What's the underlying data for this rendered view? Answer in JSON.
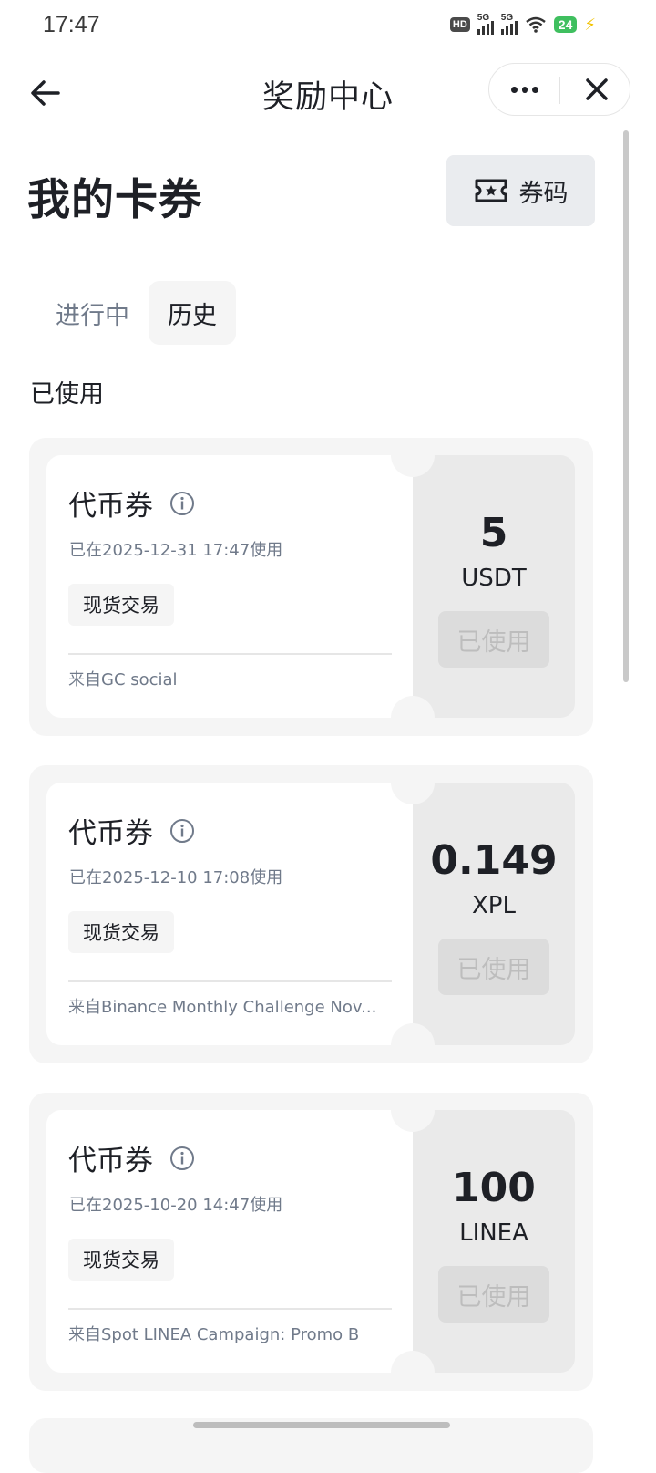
{
  "status_bar": {
    "time": "17:47",
    "hd_label": "HD",
    "net1": "5G",
    "net2": "5G",
    "battery": "24",
    "icons": [
      "hd-icon",
      "signal-icon",
      "signal-icon",
      "wifi-icon",
      "battery-icon",
      "charging-icon"
    ]
  },
  "nav": {
    "title": "奖励中心",
    "back_icon": "arrow-left-icon",
    "more_icon": "more-dots-icon",
    "close_icon": "close-icon"
  },
  "page": {
    "title": "我的卡券",
    "code_button": "券码",
    "code_icon": "ticket-star-icon"
  },
  "tabs": [
    {
      "label": "进行中",
      "active": false
    },
    {
      "label": "历史",
      "active": true
    }
  ],
  "section_label": "已使用",
  "vouchers": [
    {
      "title": "代币券",
      "date": "已在2025-12-31 17:47使用",
      "tag": "现货交易",
      "source": "来自GC social",
      "amount": "5",
      "unit": "USDT",
      "status": "已使用"
    },
    {
      "title": "代币券",
      "date": "已在2025-12-10 17:08使用",
      "tag": "现货交易",
      "source": "来自Binance Monthly Challenge Nov...",
      "amount": "0.149",
      "unit": "XPL",
      "status": "已使用"
    },
    {
      "title": "代币券",
      "date": "已在2025-10-20 14:47使用",
      "tag": "现货交易",
      "source": "来自Spot LINEA Campaign: Promo B",
      "amount": "100",
      "unit": "LINEA",
      "status": "已使用"
    }
  ],
  "colors": {
    "text_primary": "#1e2026",
    "text_secondary": "#707a8a",
    "card_bg": "#f5f5f5",
    "amount_panel": "#eaeaea",
    "used_button": "#dcdcdc",
    "battery_green": "#3fbf5f",
    "bolt_yellow": "#f2c200"
  }
}
